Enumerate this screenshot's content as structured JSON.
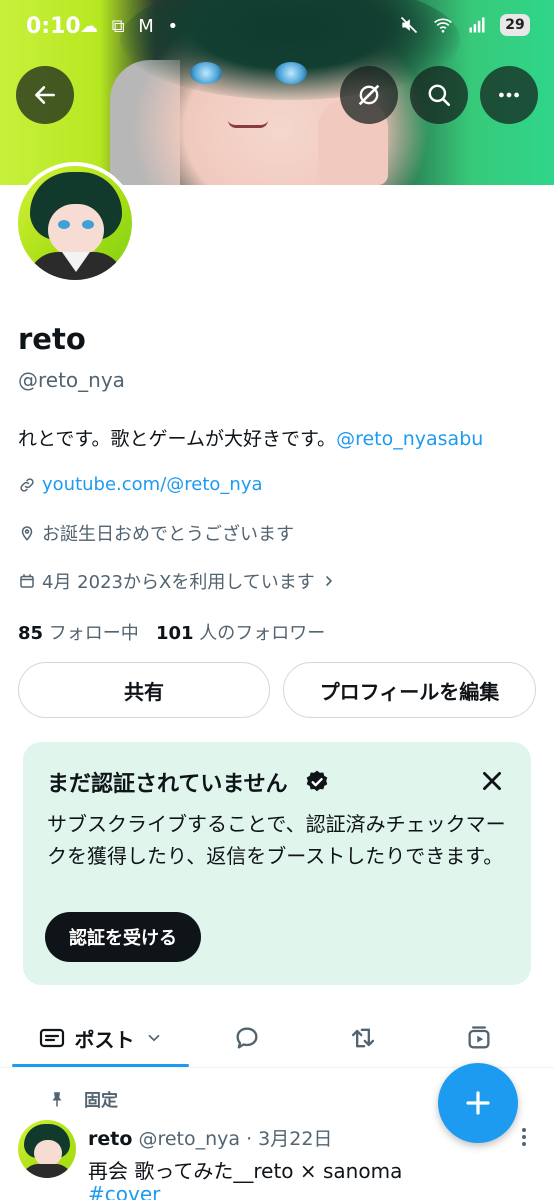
{
  "status_bar": {
    "time": "0:10",
    "left_icons": "☁ ⧉ M •",
    "battery": "29"
  },
  "header": {
    "back_icon": "arrow-left-icon",
    "grok_icon": "grok-icon",
    "search_icon": "search-icon",
    "more_icon": "more-horizontal-icon"
  },
  "profile": {
    "display_name": "reto",
    "handle": "@reto_nya",
    "bio_text": "れとです。歌とゲームが大好きです。",
    "bio_mention": "@reto_nyasabu",
    "website": "youtube.com/@reto_nya",
    "birthday": "お誕生日おめでとうございます",
    "joined": "4月 2023からXを利用しています",
    "following_count": "85",
    "following_label": "フォロー中",
    "followers_count": "101",
    "followers_label": "人のフォロワー"
  },
  "actions": {
    "share_label": "共有",
    "edit_label": "プロフィールを編集"
  },
  "verification": {
    "title": "まだ認証されていません",
    "body": "サブスクライブすることで、認証済みチェックマークを獲得したり、返信をブーストしたりできます。",
    "button_label": "認証を受ける"
  },
  "tabs": {
    "posts_label": "ポスト"
  },
  "pinned_post": {
    "pinned_label": "固定",
    "author_name": "reto",
    "author_meta": "@reto_nya · 3月22日",
    "text": "再会 歌ってみた__reto × sanoma",
    "hashtag": "#cover"
  },
  "colors": {
    "accent": "#1d9bf0",
    "text_primary": "#0f1419",
    "text_secondary": "#536471",
    "verify_bg": "#e0f6ec"
  }
}
